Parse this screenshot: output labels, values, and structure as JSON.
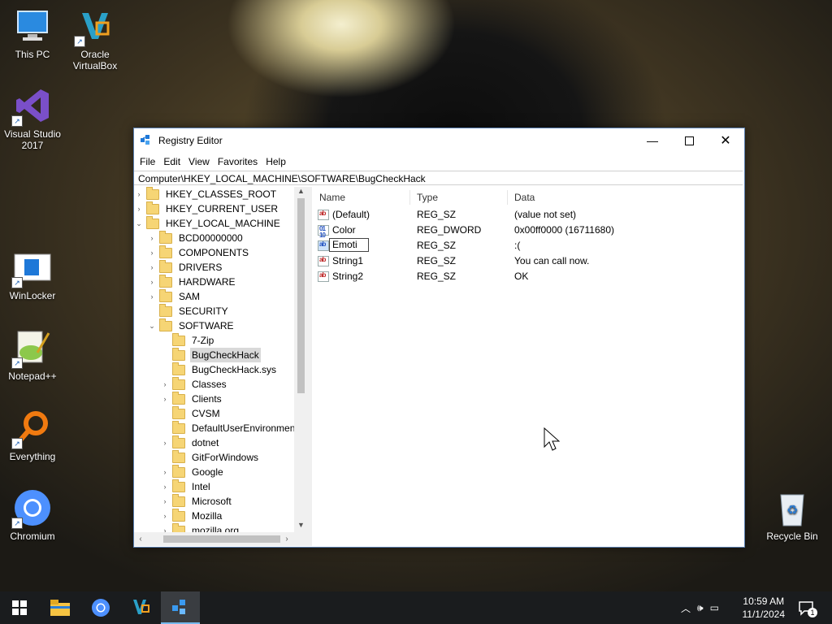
{
  "desktop": {
    "icons": [
      {
        "label": "This PC"
      },
      {
        "label": "Oracle VirtualBox"
      },
      {
        "label": "Visual Studio 2017"
      },
      {
        "label": "WinLocker"
      },
      {
        "label": "Notepad++"
      },
      {
        "label": "Everything"
      },
      {
        "label": "Chromium"
      },
      {
        "label": "Recycle Bin"
      }
    ]
  },
  "window": {
    "title": "Registry Editor",
    "menu": [
      "File",
      "Edit",
      "View",
      "Favorites",
      "Help"
    ],
    "address": "Computer\\HKEY_LOCAL_MACHINE\\SOFTWARE\\BugCheckHack",
    "tree": [
      {
        "label": "HKEY_CLASSES_ROOT",
        "chev": "›"
      },
      {
        "label": "HKEY_CURRENT_USER",
        "chev": "›"
      },
      {
        "label": "HKEY_LOCAL_MACHINE",
        "chev": "⌄"
      },
      {
        "label": "BCD00000000",
        "chev": "›"
      },
      {
        "label": "COMPONENTS",
        "chev": "›"
      },
      {
        "label": "DRIVERS",
        "chev": "›"
      },
      {
        "label": "HARDWARE",
        "chev": "›"
      },
      {
        "label": "SAM",
        "chev": "›"
      },
      {
        "label": "SECURITY",
        "chev": ""
      },
      {
        "label": "SOFTWARE",
        "chev": "⌄"
      },
      {
        "label": "7-Zip",
        "chev": ""
      },
      {
        "label": "BugCheckHack",
        "chev": ""
      },
      {
        "label": "BugCheckHack.sys",
        "chev": ""
      },
      {
        "label": "Classes",
        "chev": "›"
      },
      {
        "label": "Clients",
        "chev": "›"
      },
      {
        "label": "CVSM",
        "chev": ""
      },
      {
        "label": "DefaultUserEnvironment",
        "chev": ""
      },
      {
        "label": "dotnet",
        "chev": "›"
      },
      {
        "label": "GitForWindows",
        "chev": ""
      },
      {
        "label": "Google",
        "chev": "›"
      },
      {
        "label": "Intel",
        "chev": "›"
      },
      {
        "label": "Microsoft",
        "chev": "›"
      },
      {
        "label": "Mozilla",
        "chev": "›"
      },
      {
        "label": "mozilla.org",
        "chev": "›"
      }
    ],
    "selected_key": "BugCheckHack",
    "columns": {
      "name": "Name",
      "type": "Type",
      "data": "Data"
    },
    "values": [
      {
        "name": "(Default)",
        "type": "REG_SZ",
        "data": "(value not set)",
        "icon": "ab-string-icon"
      },
      {
        "name": "Color",
        "type": "REG_DWORD",
        "data": "0x00ff0000 (16711680)",
        "icon": "binary-value-icon"
      },
      {
        "name": "Emoti",
        "type": "REG_SZ",
        "data": ":(",
        "icon": "binary-value-icon",
        "renaming": true
      },
      {
        "name": "String1",
        "type": "REG_SZ",
        "data": "You can call now.",
        "icon": "ab-string-icon"
      },
      {
        "name": "String2",
        "type": "REG_SZ",
        "data": "OK",
        "icon": "ab-string-icon"
      }
    ]
  },
  "taskbar": {
    "time": "10:59 AM",
    "date": "11/1/2024",
    "notification_count": "1"
  }
}
